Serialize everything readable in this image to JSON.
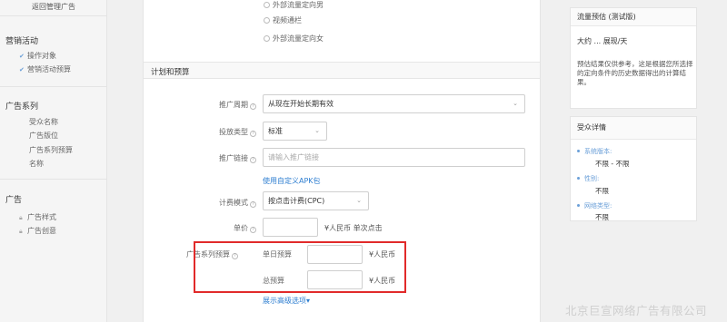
{
  "sidebar": {
    "back_label": "返回管理广告",
    "marketing": {
      "title": "营销活动",
      "items": [
        {
          "label": "操作对象",
          "icon": "check-icon"
        },
        {
          "label": "营销活动预算",
          "icon": "check-icon"
        }
      ]
    },
    "ad_series": {
      "title": "广告系列",
      "items": [
        {
          "label": "受众名称"
        },
        {
          "label": "广告版位"
        },
        {
          "label": "广告系列预算"
        },
        {
          "label": "名称"
        }
      ]
    },
    "ad": {
      "title": "广告",
      "items": [
        {
          "label": "广告样式",
          "icon": "lock-icon"
        },
        {
          "label": "广告创意",
          "icon": "lock-icon"
        }
      ]
    }
  },
  "main": {
    "targeting_options": [
      {
        "label": "外部流量定向男"
      },
      {
        "label": "视频通栏"
      },
      {
        "label": "外部流量定向女"
      }
    ],
    "section_title": "计划和预算",
    "promotion_period": {
      "label": "推广周期",
      "value": "从现在开始长期有效"
    },
    "delivery_type": {
      "label": "投放类型",
      "value": "标准"
    },
    "promo_link": {
      "label": "推广链接",
      "placeholder": "请输入推广链接",
      "apk_link": "使用自定义APK包"
    },
    "billing_mode": {
      "label": "计费模式",
      "value": "按点击计费(CPC)"
    },
    "unit_price": {
      "label": "单价",
      "value": "",
      "unit": "¥人民币 单次点击"
    },
    "series_budget": {
      "label": "广告系列预算",
      "daily_label": "单日预算",
      "daily_value": "",
      "daily_unit": "¥人民币",
      "total_label": "总预算",
      "total_value": "",
      "total_unit": "¥人民币"
    },
    "advanced_link": "展示高级选项▾"
  },
  "traffic_panel": {
    "title": "流量预估 (测试版)",
    "estimate": "大约 ... 展现/天",
    "note": "预估结果仅供参考，这是根据您所选择的定向条件的历史数据得出的计算结果。"
  },
  "audience_panel": {
    "title": "受众详情",
    "items": [
      {
        "key": "系统版本:",
        "value": "不限 - 不限"
      },
      {
        "key": "性别:",
        "value": "不限"
      },
      {
        "key": "网络类型:",
        "value": "不限"
      }
    ]
  },
  "watermark": "北京巨宣网络广告有限公司",
  "colors": {
    "accent_blue": "#2f7fd1",
    "highlight_red": "#e12a2a",
    "sidebar_bg": "#f5f5f5"
  }
}
